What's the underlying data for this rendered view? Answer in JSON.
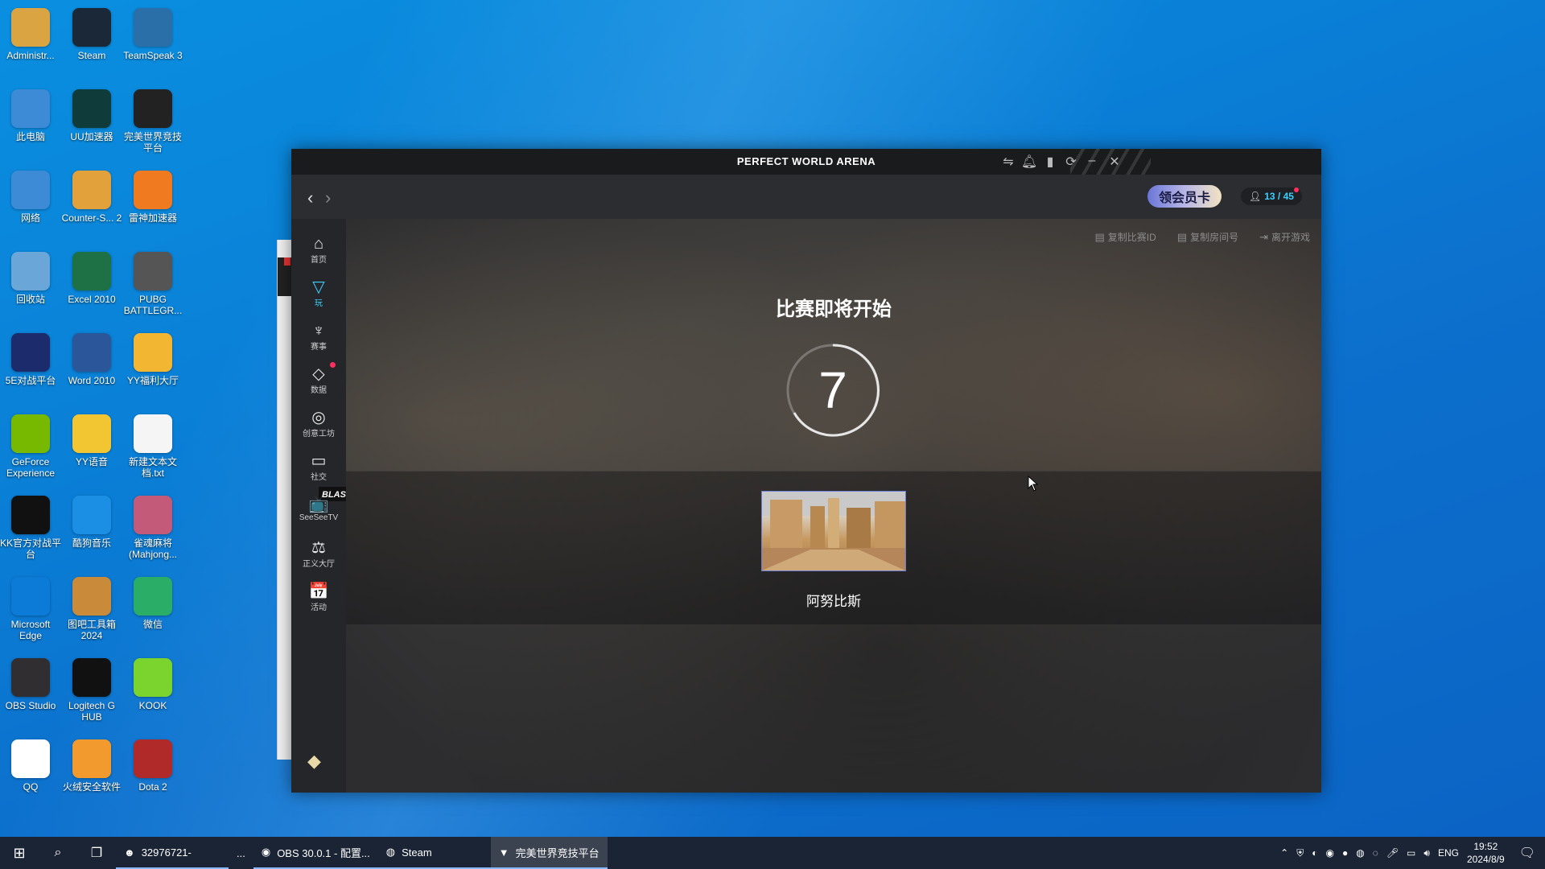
{
  "desktop_icons": [
    {
      "label": "Administr...",
      "icon": "user-folder-icon",
      "color": "#d9a441"
    },
    {
      "label": "Steam",
      "icon": "steam-icon",
      "color": "#1b2838"
    },
    {
      "label": "TeamSpeak 3",
      "icon": "teamspeak-icon",
      "color": "#2a6fa8"
    },
    {
      "label": "此电脑",
      "icon": "computer-icon",
      "color": "#3d8ad6"
    },
    {
      "label": "UU加速器",
      "icon": "uu-accelerator-icon",
      "color": "#0f3b3b"
    },
    {
      "label": "完美世界竞技平台",
      "icon": "perfect-world-arena-icon",
      "color": "#222222"
    },
    {
      "label": "网络",
      "icon": "network-icon",
      "color": "#3d8ad6"
    },
    {
      "label": "Counter-S... 2",
      "icon": "counter-strike-icon",
      "color": "#e3a13b"
    },
    {
      "label": "雷神加速器",
      "icon": "leishen-accelerator-icon",
      "color": "#f07a20"
    },
    {
      "label": "回收站",
      "icon": "recycle-bin-icon",
      "color": "#6aa7d8"
    },
    {
      "label": "Excel 2010",
      "icon": "excel-icon",
      "color": "#1e7145"
    },
    {
      "label": "PUBG BATTLEGR...",
      "icon": "pubg-icon",
      "color": "#555555"
    },
    {
      "label": "5E对战平台",
      "icon": "5e-platform-icon",
      "color": "#1b2b6b"
    },
    {
      "label": "Word 2010",
      "icon": "word-icon",
      "color": "#2b579a"
    },
    {
      "label": "YY福利大厅",
      "icon": "yy-welfare-icon",
      "color": "#f2b632"
    },
    {
      "label": "GeForce Experience",
      "icon": "geforce-icon",
      "color": "#76b900"
    },
    {
      "label": "YY语音",
      "icon": "yy-voice-icon",
      "color": "#f2c632"
    },
    {
      "label": "新建文本文档.txt",
      "icon": "text-file-icon",
      "color": "#f5f5f5"
    },
    {
      "label": "KK官方对战平台",
      "icon": "kk-platform-icon",
      "color": "#111111"
    },
    {
      "label": "酷狗音乐",
      "icon": "kugou-music-icon",
      "color": "#1a8fe3"
    },
    {
      "label": "雀魂麻将(Mahjong...",
      "icon": "mahjong-soul-icon",
      "color": "#c35a7a"
    },
    {
      "label": "Microsoft Edge",
      "icon": "edge-icon",
      "color": "#0c7bd8"
    },
    {
      "label": "图吧工具箱2024",
      "icon": "tuba-toolbox-icon",
      "color": "#c98a3a"
    },
    {
      "label": "微信",
      "icon": "wechat-icon",
      "color": "#2aae67"
    },
    {
      "label": "OBS Studio",
      "icon": "obs-icon",
      "color": "#302e31"
    },
    {
      "label": "Logitech G HUB",
      "icon": "logitech-ghub-icon",
      "color": "#111111"
    },
    {
      "label": "KOOK",
      "icon": "kook-icon",
      "color": "#7bd32e"
    },
    {
      "label": "QQ",
      "icon": "qq-icon",
      "color": "#ffffff"
    },
    {
      "label": "火绒安全软件",
      "icon": "huorong-icon",
      "color": "#f29a2e"
    },
    {
      "label": "Dota 2",
      "icon": "dota2-icon",
      "color": "#b02a2a"
    }
  ],
  "app": {
    "title": "PERFECT WORLD ARENA",
    "vip_label": "领会员卡",
    "online": {
      "count": "13 / 45"
    },
    "sidebar": [
      {
        "label": "首页",
        "icon": "home-icon",
        "glyph": "⌂"
      },
      {
        "label": "玩",
        "icon": "play-wifi-icon",
        "glyph": "▽",
        "active": true
      },
      {
        "label": "赛事",
        "icon": "trophy-icon",
        "glyph": "♆"
      },
      {
        "label": "数据",
        "icon": "data-diamond-icon",
        "glyph": "◇",
        "badge": true
      },
      {
        "label": "创意工坊",
        "icon": "workshop-planet-icon",
        "glyph": "◎"
      },
      {
        "label": "社交",
        "icon": "social-chat-icon",
        "glyph": "▭",
        "tag": "BLAST 秋季赛"
      },
      {
        "label": "SeeSeeTV",
        "icon": "tv-icon",
        "glyph": "📺"
      },
      {
        "label": "正义大厅",
        "icon": "justice-scale-icon",
        "glyph": "⚖"
      },
      {
        "label": "活动",
        "icon": "event-calendar-icon",
        "glyph": "📅"
      }
    ],
    "toolbar": {
      "copy_match_id": "复制比赛ID",
      "copy_room": "复制房间号",
      "leave_game": "离开游戏"
    },
    "match": {
      "title": "比赛即将开始",
      "countdown": "7",
      "map_name": "阿努比斯"
    }
  },
  "taskbar": {
    "items": [
      {
        "label": "32976721-",
        "icon": "yy-voice-icon",
        "state": "running"
      },
      {
        "label": "...",
        "icon": "",
        "state": ""
      },
      {
        "label": "OBS 30.0.1 - 配置...",
        "icon": "obs-icon",
        "state": "running"
      },
      {
        "label": "Steam",
        "icon": "steam-icon",
        "state": "running"
      },
      {
        "label": "完美世界竞技平台",
        "icon": "perfect-world-arena-icon",
        "state": "active"
      }
    ],
    "lang": "ENG",
    "time": "19:52",
    "date": "2024/8/9"
  }
}
